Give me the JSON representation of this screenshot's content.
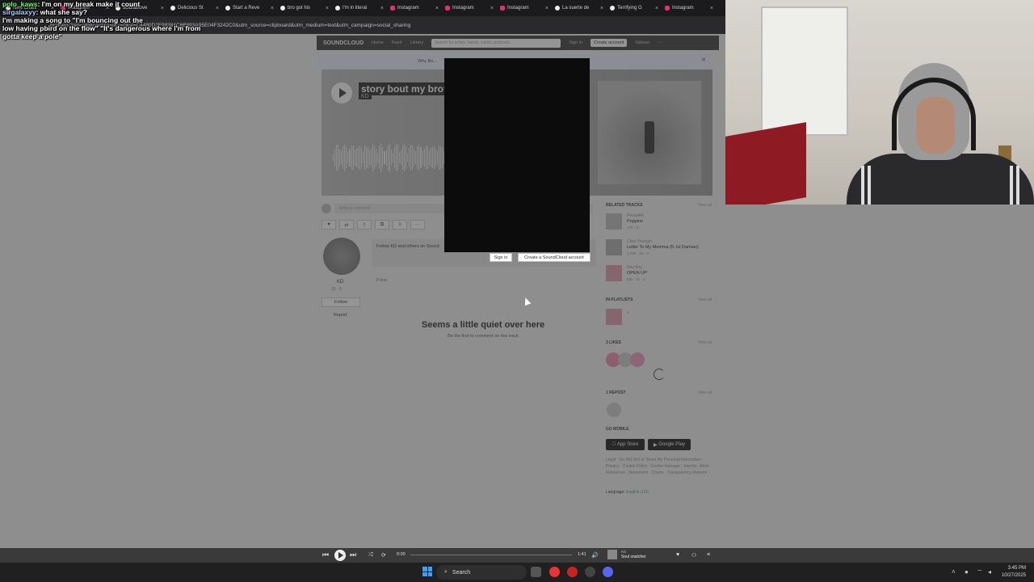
{
  "tabs": [
    {
      "label": "New Charli",
      "icon": "tiktok-icon"
    },
    {
      "label": "Instagram",
      "icon": "instagram-icon"
    },
    {
      "label": "acidfablove",
      "icon": "tiktok-icon"
    },
    {
      "label": "Delicious St",
      "icon": "tiktok-icon"
    },
    {
      "label": "Start a Reve",
      "icon": "tiktok-icon"
    },
    {
      "label": "bro got his",
      "icon": "tiktok-icon"
    },
    {
      "label": "I'm in literal",
      "icon": "tiktok-icon"
    },
    {
      "label": "Instagram",
      "icon": "instagram-icon"
    },
    {
      "label": "Instagram",
      "icon": "instagram-icon"
    },
    {
      "label": "Instagram",
      "icon": "instagram-icon"
    },
    {
      "label": "La suerte de",
      "icon": "tiktok-icon"
    },
    {
      "label": "Terrifying G",
      "icon": "tiktok-icon"
    },
    {
      "label": "Instagram",
      "icon": "instagram-icon"
    }
  ],
  "url": "-brothers?ref=clipboard&p=i&c=0&si=C4480D2F98384C6B893A95E04F3242C0&utm_source=clipboard&utm_medium=text&utm_campaign=social_sharing",
  "chat": [
    {
      "user": "polo_kaws",
      "text": "I'm on my break make it count",
      "color": "u1"
    },
    {
      "user": "sirgalaxyy",
      "text": "what she say?",
      "color": "u2"
    },
    {
      "user": "",
      "text": "I'm making a song to \"I'm bouncing out the",
      "color": "u3"
    },
    {
      "user": "",
      "text": "low having pbird on the flow\" \"It's dangerous where I'm from",
      "color": ""
    },
    {
      "user": "",
      "text": "gotta keep a pole\"",
      "color": ""
    }
  ],
  "header": {
    "logo": "SOUNDCLOUD",
    "nav": [
      "Home",
      "Feed",
      "Library"
    ],
    "search_placeholder": "Search for artists, bands, tracks, podcasts",
    "sign_in": "Sign in",
    "create_account": "Create account",
    "upload": "Upload"
  },
  "banner": {
    "text": "Why Bo..."
  },
  "track": {
    "title": "story bout my broth",
    "artist": "KD"
  },
  "comment": {
    "placeholder": "Write a comment"
  },
  "uploader": {
    "name": "KD",
    "stats": "22 · 5",
    "follow": "Follow",
    "report": "Report",
    "follow_text": "Follow KD and others on Sound",
    "p_line": "P-line:"
  },
  "signin_bar": {
    "sign_in": "Sign in",
    "create": "Create a SoundCloud account"
  },
  "empty_comments": {
    "title": "Seems a little quiet over here",
    "subtitle": "Be the first to comment on this track"
  },
  "sidebar": {
    "related_heading": "RELATED TRACKS",
    "view_all": "View all",
    "related": [
      {
        "artist": "Peezy4th",
        "title": "Poppin¤",
        "stats": "175 · 8"
      },
      {
        "artist": "Chris Youngin",
        "title": "Letter To My Momma (ft. lul Damian)",
        "stats": "1,783 · 20 · 3"
      },
      {
        "artist": "Rey Bey",
        "title": "OPEN UP",
        "stats": "638 · 11 · 1"
      }
    ],
    "playlists_heading": "IN PLAYLISTS",
    "playlist_stats": "2",
    "likes_heading": "3 LIKES",
    "repost_heading": "1 REPOST",
    "go_mobile": "GO MOBILE",
    "app_store": "App Store",
    "google_play": "Google Play",
    "legal": "Legal · Do Not Sell or Share My Personal Information · Privacy · Cookie Policy · Cookie Manager · Imprint · Artist Resources · Newsroom · Charts · Transparency Reports",
    "language_label": "Language:",
    "language": "English (US)"
  },
  "player": {
    "elapsed": "0:00",
    "duration": "1:41",
    "now_artist": "KD",
    "now_title": "Soul snatcher",
    "progress": 0
  },
  "taskbar": {
    "search": "Search",
    "time": "3:45 PM",
    "date": "10/27/2025"
  },
  "colors": {
    "accent": "#ff5500",
    "dim": "#3c3c3c"
  }
}
